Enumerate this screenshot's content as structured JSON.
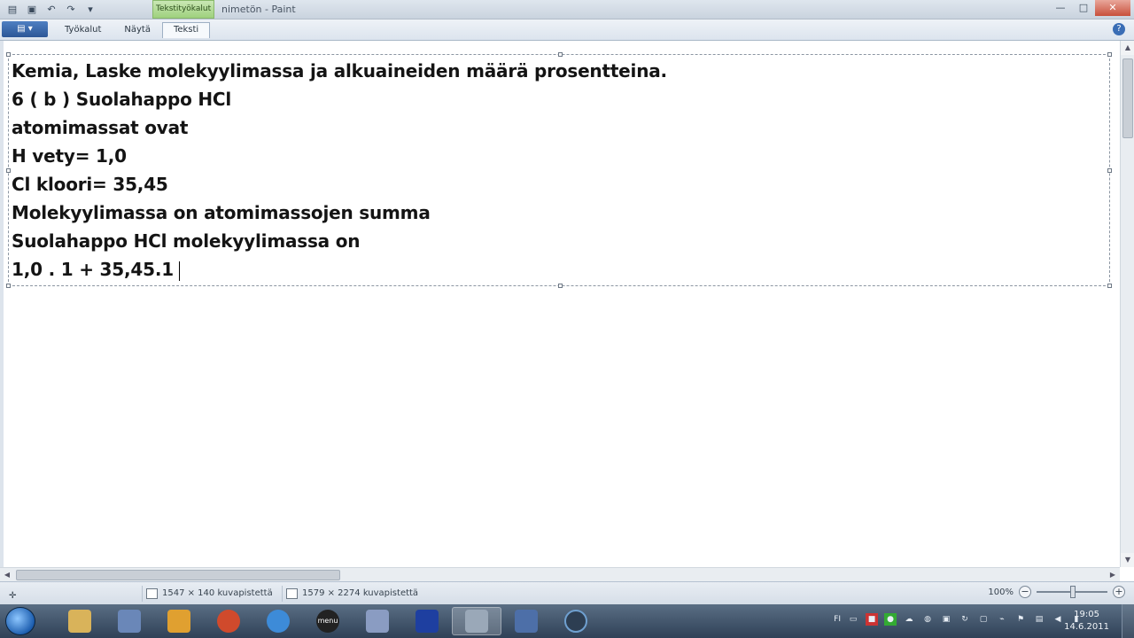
{
  "window": {
    "context_tab": "Tekstityökalut",
    "title": "nimetön - Paint",
    "buttons": {
      "minimize": "—",
      "maximize": "□",
      "close": "✕"
    }
  },
  "ribbon": {
    "app_menu": "▤ ▾",
    "tabs": [
      "Työkalut",
      "Näytä",
      "Teksti"
    ],
    "help": "?"
  },
  "document": {
    "lines": [
      "Kemia, Laske molekyylimassa ja alkuaineiden määrä prosentteina.",
      "6 ( b ) Suolahappo HCl",
      "atomimassat ovat",
      "H vety= 1,0",
      "Cl kloori= 35,45",
      "Molekyylimassa on atomimassojen summa",
      "Suolahappo HCl molekyylimassa on",
      "1,0 . 1 + 35,45.1"
    ]
  },
  "statusbar": {
    "selection_size": "1547 × 140 kuvapistettä",
    "image_size": "1579 × 2274 kuvapistettä",
    "zoom": "100%",
    "zoom_minus": "−",
    "zoom_plus": "+"
  },
  "taskbar": {
    "icons": [
      "explorer-icon",
      "tools-icon",
      "media-icon",
      "browser-icon",
      "ie-icon",
      "menu-icon",
      "paint-icon",
      "network-icon",
      "settings-icon",
      "save-icon",
      "recorder-icon"
    ],
    "menu_label": "menu",
    "language": "FI",
    "time": "19:05",
    "date": "14.6.2011"
  }
}
